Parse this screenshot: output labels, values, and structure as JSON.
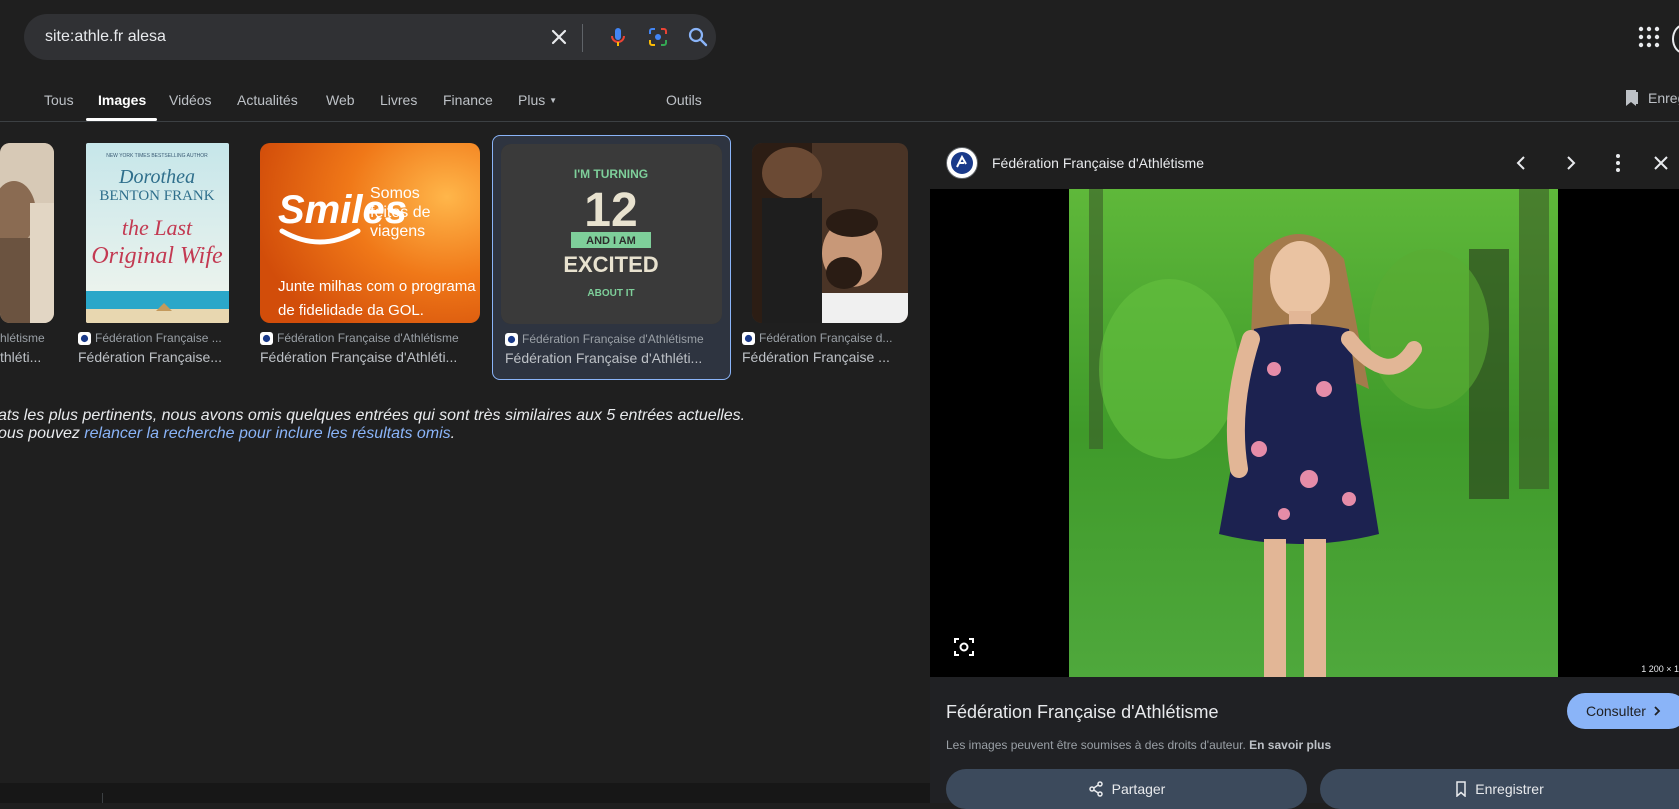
{
  "search": {
    "query": "site:athle.fr alesa"
  },
  "tabs": [
    {
      "label": "Tous"
    },
    {
      "label": "Images"
    },
    {
      "label": "Vidéos"
    },
    {
      "label": "Actualités"
    },
    {
      "label": "Web"
    },
    {
      "label": "Livres"
    },
    {
      "label": "Finance"
    },
    {
      "label": "Plus"
    }
  ],
  "tools_label": "Outils",
  "save_top_label": "Enreg",
  "results": [
    {
      "source": "hlétisme",
      "title": "thléti..."
    },
    {
      "source": "Fédération Française ...",
      "title": "Fédération Française..."
    },
    {
      "source": "Fédération Française d'Athlétisme",
      "title": "Fédération Française d'Athléti..."
    },
    {
      "source": "Fédération Française d'Athlétisme",
      "title": "Fédération Française d'Athléti..."
    },
    {
      "source": "Fédération Française d...",
      "title": "Fédération Française ..."
    }
  ],
  "thumbs": {
    "book": {
      "top": "NEW YORK TIMES BESTSELLING AUTHOR",
      "author1": "Dorothea",
      "author2": "BENTON FRANK",
      "title1": "the Last",
      "title2": "Original Wife"
    },
    "smiles": {
      "brand": "Smiles",
      "tag1": "Somos",
      "tag2": "feitos de",
      "tag3": "viagens",
      "line1": "Junte milhas com o programa",
      "line2": "de fidelidade da GOL."
    },
    "excited": {
      "l1": "I'M TURNING",
      "num": "12",
      "l2": "AND I AM",
      "l3": "EXCITED",
      "l4": "ABOUT IT"
    }
  },
  "notice": {
    "line1": "ats les plus pertinents, nous avons omis quelques entrées qui sont très similaires aux 5 entrées actuelles.",
    "line2_prefix": "ous pouvez ",
    "line2_link": "relancer la recherche pour inclure les résultats omis",
    "line2_suffix": "."
  },
  "panel": {
    "site_name": "Fédération Française d'Athlétisme",
    "dimensions": "1 200 × 1",
    "title": "Fédération Française d'Athlétisme",
    "consult_label": "Consulter",
    "rights_text": "Les images peuvent être soumises à des droits d'auteur.",
    "rights_link": "En savoir plus",
    "share_label": "Partager",
    "save_label": "Enregistrer"
  }
}
